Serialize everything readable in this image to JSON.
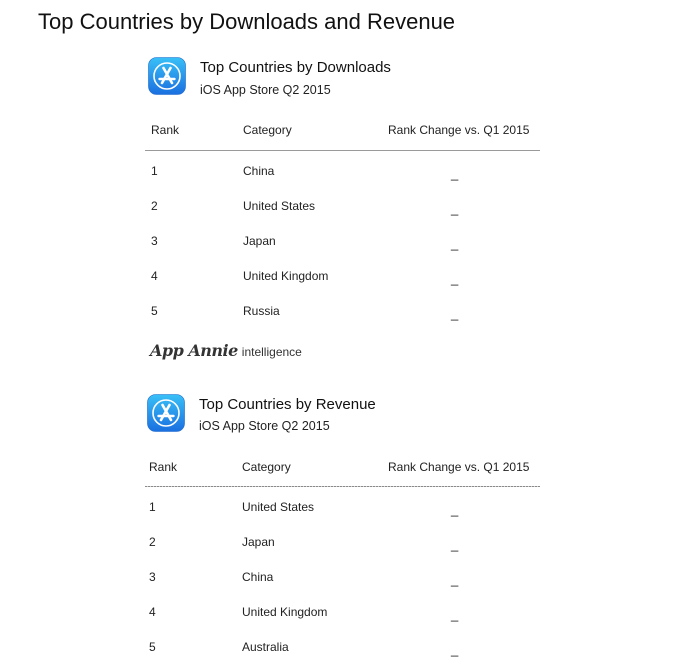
{
  "page_title": "Top Countries by Downloads and Revenue",
  "accent_colors": {
    "icon_top": "#39c0f7",
    "icon_bottom": "#1a6fe0"
  },
  "downloads": {
    "title": "Top Countries by Downloads",
    "subtitle": "iOS App Store Q2 2015",
    "columns": {
      "rank": "Rank",
      "category": "Category",
      "change": "Rank Change vs. Q1 2015"
    },
    "rows": [
      {
        "rank": "1",
        "category": "China",
        "change": "_"
      },
      {
        "rank": "2",
        "category": "United States",
        "change": "_"
      },
      {
        "rank": "3",
        "category": "Japan",
        "change": "_"
      },
      {
        "rank": "4",
        "category": "United Kingdom",
        "change": "_"
      },
      {
        "rank": "5",
        "category": "Russia",
        "change": "_"
      }
    ]
  },
  "watermark": {
    "brand": "App Annie",
    "suffix": "intelligence"
  },
  "revenue": {
    "title": "Top Countries by Revenue",
    "subtitle": "iOS App Store Q2 2015",
    "columns": {
      "rank": "Rank",
      "category": "Category",
      "change": "Rank Change vs. Q1 2015"
    },
    "rows": [
      {
        "rank": "1",
        "category": "United States",
        "change": "_"
      },
      {
        "rank": "2",
        "category": "Japan",
        "change": "_"
      },
      {
        "rank": "3",
        "category": "China",
        "change": "_"
      },
      {
        "rank": "4",
        "category": "United Kingdom",
        "change": "_"
      },
      {
        "rank": "5",
        "category": "Australia",
        "change": "_"
      }
    ]
  }
}
